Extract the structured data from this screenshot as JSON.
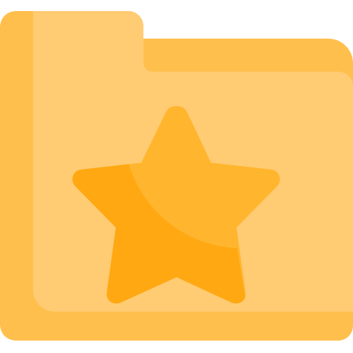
{
  "icon": {
    "name": "favorite-folder-icon",
    "depicts": [
      "folder-icon",
      "star-icon"
    ],
    "colors": {
      "background": "#ffffff",
      "folder_back": "#ffbf4d",
      "folder_front": "#ffcb73",
      "star_light": "#ffb52d",
      "star_dark": "#ffa812"
    }
  }
}
